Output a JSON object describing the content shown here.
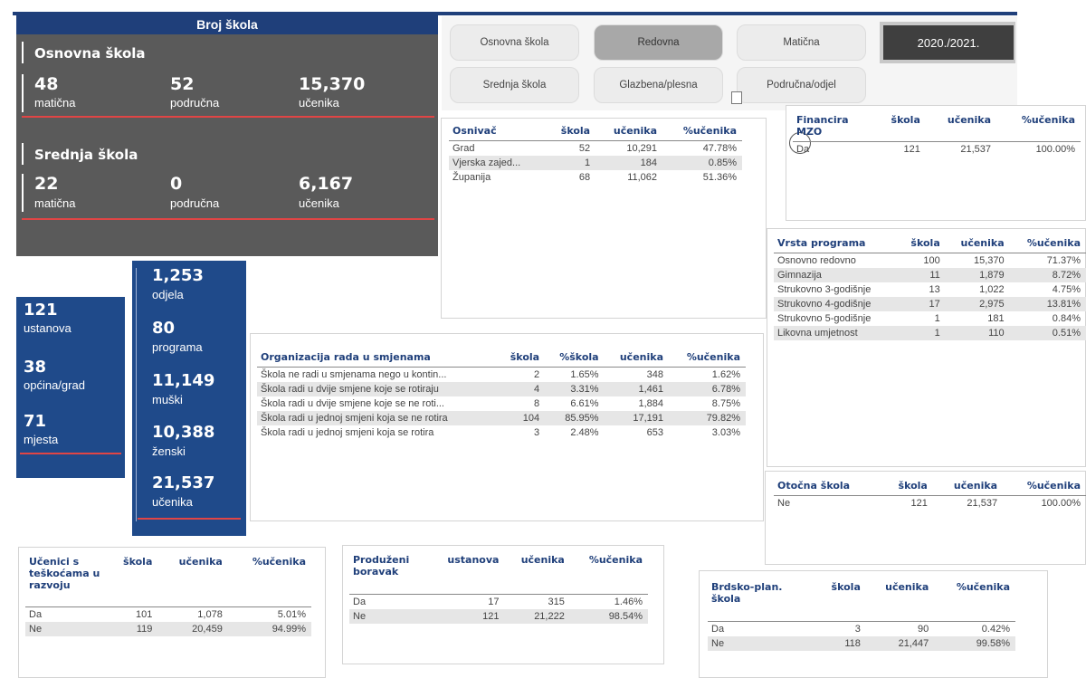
{
  "school_counts": {
    "title": "Broj škola",
    "primary": {
      "title": "Osnovna škola",
      "maticna_value": "48",
      "maticna_label": "matična",
      "podrucna_value": "52",
      "podrucna_label": "područna",
      "students_value": "15,370",
      "students_label": "učenika"
    },
    "secondary": {
      "title": "Srednja škola",
      "maticna_value": "22",
      "maticna_label": "matična",
      "podrucna_value": "0",
      "podrucna_label": "područna",
      "students_value": "6,167",
      "students_label": "učenika"
    }
  },
  "filters": {
    "osnovna": "Osnovna škola",
    "redovna": "Redovna",
    "maticna": "Matična",
    "year": "2020./2021.",
    "srednja": "Srednja škola",
    "glazbena": "Glazbena/plesna",
    "podrucna": "Područna/odjel"
  },
  "osnivac_table": {
    "headers": [
      "Osnivač",
      "škola",
      "učenika",
      "%učenika"
    ],
    "rows": [
      [
        "Grad",
        "52",
        "10,291",
        "47.78%"
      ],
      [
        "Vjerska zajed...",
        "1",
        "184",
        "0.85%"
      ],
      [
        "Županija",
        "68",
        "11,062",
        "51.36%"
      ]
    ]
  },
  "financira_table": {
    "headers": [
      "Financira MZO",
      "škola",
      "učenika",
      "%učenika"
    ],
    "rows": [
      [
        "Da",
        "121",
        "21,537",
        "100.00%"
      ]
    ]
  },
  "vrsta_table": {
    "headers": [
      "Vrsta programa",
      "škola",
      "učenika",
      "%učenika"
    ],
    "rows": [
      [
        "Osnovno redovno",
        "100",
        "15,370",
        "71.37%"
      ],
      [
        "Gimnazija",
        "11",
        "1,879",
        "8.72%"
      ],
      [
        "Strukovno 3-godišnje",
        "13",
        "1,022",
        "4.75%"
      ],
      [
        "Strukovno 4-godišnje",
        "17",
        "2,975",
        "13.81%"
      ],
      [
        "Strukovno 5-godišnje",
        "1",
        "181",
        "0.84%"
      ],
      [
        "Likovna umjetnost",
        "1",
        "110",
        "0.51%"
      ]
    ]
  },
  "totals_left": {
    "ustanova_value": "121",
    "ustanova_label": "ustanova",
    "opcina_value": "38",
    "opcina_label": "općina/grad",
    "mjesta_value": "71",
    "mjesta_label": "mjesta"
  },
  "totals_right": {
    "odjela_value": "1,253",
    "odjela_label": "odjela",
    "programa_value": "80",
    "programa_label": "programa",
    "muski_value": "11,149",
    "muski_label": "muški",
    "zenski_value": "10,388",
    "zenski_label": "ženski",
    "ucenika_value": "21,537",
    "ucenika_label": "učenika"
  },
  "smjene_table": {
    "headers": [
      "Organizacija rada u smjenama",
      "škola",
      "%škola",
      "učenika",
      "%učenika"
    ],
    "rows": [
      [
        "Škola ne radi u smjenama nego u kontin...",
        "2",
        "1.65%",
        "348",
        "1.62%"
      ],
      [
        "Škola radi u dvije smjene  koje se rotiraju",
        "4",
        "3.31%",
        "1,461",
        "6.78%"
      ],
      [
        "Škola radi u dvije smjene koje se ne roti...",
        "8",
        "6.61%",
        "1,884",
        "8.75%"
      ],
      [
        "Škola radi u jednoj smjeni koja se ne rotira",
        "104",
        "85.95%",
        "17,191",
        "79.82%"
      ],
      [
        "Škola radi u jednoj smjeni koja se rotira",
        "3",
        "2.48%",
        "653",
        "3.03%"
      ]
    ]
  },
  "otocna_table": {
    "headers": [
      "Otočna škola",
      "škola",
      "učenika",
      "%učenika"
    ],
    "rows": [
      [
        "Ne",
        "121",
        "21,537",
        "100.00%"
      ]
    ]
  },
  "teskoce_table": {
    "headers": [
      "Učenici s teškoćama u razvoju",
      "škola",
      "učenika",
      "%učenika"
    ],
    "rows": [
      [
        "Da",
        "101",
        "1,078",
        "5.01%"
      ],
      [
        "Ne",
        "119",
        "20,459",
        "94.99%"
      ]
    ]
  },
  "boravak_table": {
    "headers": [
      "Produženi boravak",
      "ustanova",
      "učenika",
      "%učenika"
    ],
    "rows": [
      [
        "Da",
        "17",
        "315",
        "1.46%"
      ],
      [
        "Ne",
        "121",
        "21,222",
        "98.54%"
      ]
    ]
  },
  "brdsko_table": {
    "headers": [
      "Brdsko-plan. škola",
      "škola",
      "učenika",
      "%učenika"
    ],
    "rows": [
      [
        "Da",
        "3",
        "90",
        "0.42%"
      ],
      [
        "Ne",
        "118",
        "21,447",
        "99.58%"
      ]
    ]
  }
}
